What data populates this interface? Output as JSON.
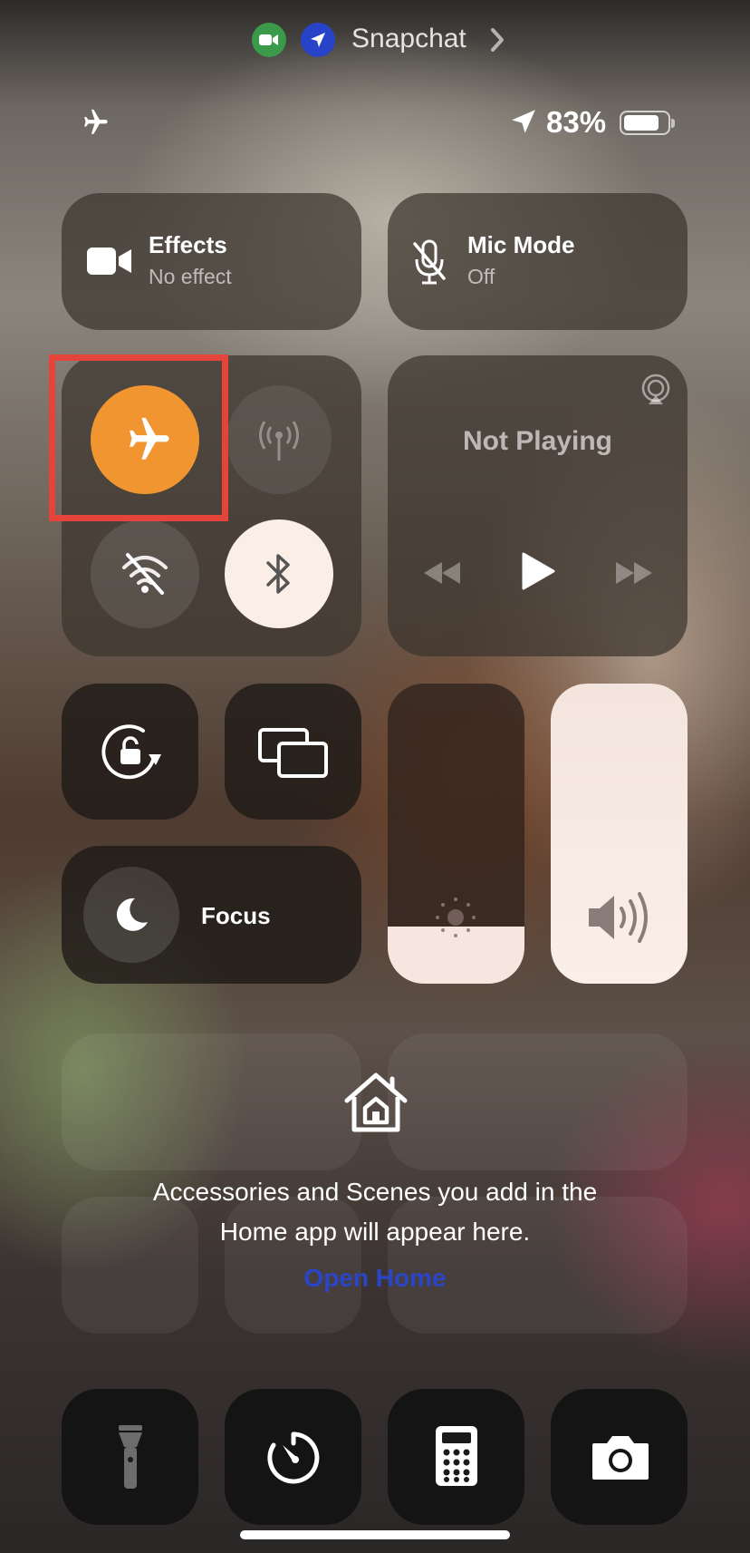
{
  "top_indicator": {
    "app_name": "Snapchat"
  },
  "status_bar": {
    "battery_percent": "83%",
    "battery_level": 0.83
  },
  "effects": {
    "title": "Effects",
    "subtitle": "No effect"
  },
  "mic_mode": {
    "title": "Mic Mode",
    "subtitle": "Off"
  },
  "media": {
    "status": "Not Playing"
  },
  "focus": {
    "label": "Focus"
  },
  "sliders": {
    "brightness_level": 0.19,
    "volume_level": 1.0
  },
  "home": {
    "message_line1": "Accessories and Scenes you add in the",
    "message_line2": "Home app will appear here.",
    "open_home_label": "Open Home"
  },
  "colors": {
    "airplane_active": "#f0952f",
    "bluetooth_active": "#fbeee6",
    "open_home_link": "#2a45c8",
    "highlight_box": "#e5443a"
  }
}
